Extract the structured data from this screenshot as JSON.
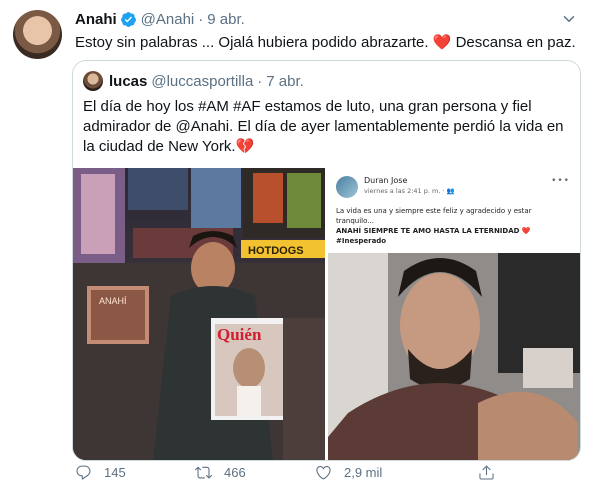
{
  "tweet": {
    "author_name": "Anahi",
    "author_handle": "@Anahi",
    "separator": "·",
    "date": "9 abr.",
    "text_main": "Estoy sin palabras ... Ojalá hubiera podido abrazarte. ",
    "text_emoji": "❤️",
    "text_end": " Descansa en paz."
  },
  "quoted": {
    "author_name": "lucas",
    "author_handle": "@luccasportilla",
    "separator": "·",
    "date": "7 abr.",
    "lines": [
      "El día de hoy los #AM #AF estamos de luto, una gran persona y fiel",
      "admirador de @Anahi. El día de ayer lamentablemente perdió la vida en",
      "la ciudad de New York."
    ],
    "line3_emoji": "💔"
  },
  "embedded_post": {
    "author": "Duran Jose",
    "meta": "viernes a las 2:41 p. m. · ",
    "lines": [
      "La vida es una y siempre este feliz y agradecido y estar",
      "tranquilo..."
    ],
    "bold_line": "ANAHÍ SIEMPRE TE AMO HASTA LA ETERNIDAD ❤️",
    "hashtag": "#Inesperado"
  },
  "photo_text": {
    "magazine": "Quién",
    "street_sign": "HOTDOGS",
    "album": "ANAHÍ"
  },
  "actions": {
    "reply_count": "145",
    "retweet_count": "466",
    "like_count": "2,9 mil"
  },
  "colors": {
    "accent": "#1da1f2",
    "muted": "#5b7083",
    "heart": "#e0245e",
    "border": "#cfd9de"
  },
  "icons": [
    "verified-badge-icon",
    "caret-down-icon",
    "reply-icon",
    "retweet-icon",
    "like-icon",
    "share-icon",
    "friends-icon",
    "more-icon"
  ]
}
